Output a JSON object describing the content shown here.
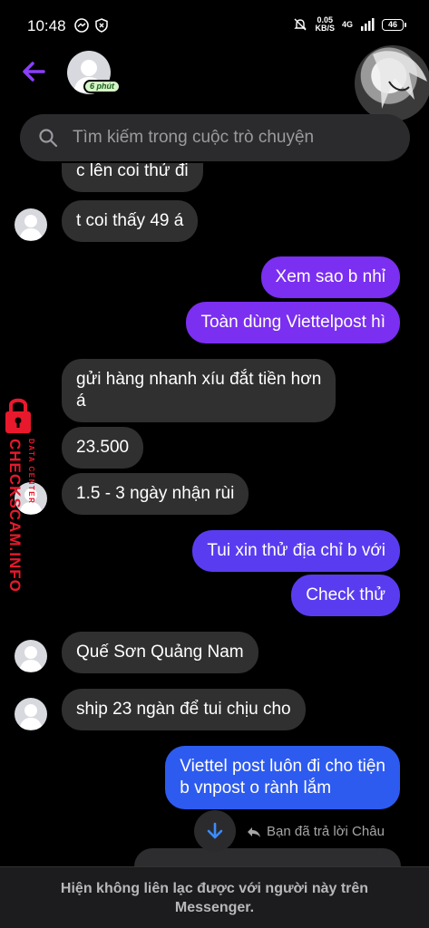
{
  "status_bar": {
    "time": "10:48",
    "net_speed_value": "0.05",
    "net_speed_unit": "KB/S",
    "network": "4G",
    "battery": "46"
  },
  "header": {
    "active_badge": "6 phút"
  },
  "search": {
    "placeholder": "Tìm kiếm trong cuộc trò chuyện"
  },
  "messages": [
    {
      "from": "them",
      "text": "c lên coi thử đi"
    },
    {
      "from": "them",
      "text": "t coi thấy 49 á"
    },
    {
      "from": "me",
      "text": "Xem sao b nhỉ"
    },
    {
      "from": "me",
      "text": "Toàn dùng Viettelpost hì"
    },
    {
      "from": "them",
      "text_line1": "gửi hàng nhanh xíu đắt tiền hơn",
      "text_line2": "á"
    },
    {
      "from": "them",
      "text": "23.500"
    },
    {
      "from": "them",
      "text": "1.5 - 3 ngày nhận rùi"
    },
    {
      "from": "me",
      "text": "Tui xin thử địa chỉ b với"
    },
    {
      "from": "me",
      "text": "Check thử"
    },
    {
      "from": "them",
      "text": "Quế Sơn Quảng Nam"
    },
    {
      "from": "them",
      "text": "ship 23 ngàn để tui chịu cho"
    },
    {
      "from": "me",
      "text_line1": "Viettel post luôn đi cho tiện",
      "text_line2": "b vnpost o rành lắm"
    }
  ],
  "reply_indicator": "Bạn đã trả lời Châu",
  "watermark": {
    "brand": "CHECKSCAM.INFO",
    "sub": "DATA CENTER"
  },
  "footer": {
    "notice": "Hiện không liên lạc được với người này trên Messenger."
  },
  "colors": {
    "accent": "#8a3ffc",
    "bubble_in": "#303030",
    "bubble_out_purple": "#7b2ff0",
    "bubble_out_blue": "#2d5bf0",
    "watermark": "#e8192c"
  }
}
